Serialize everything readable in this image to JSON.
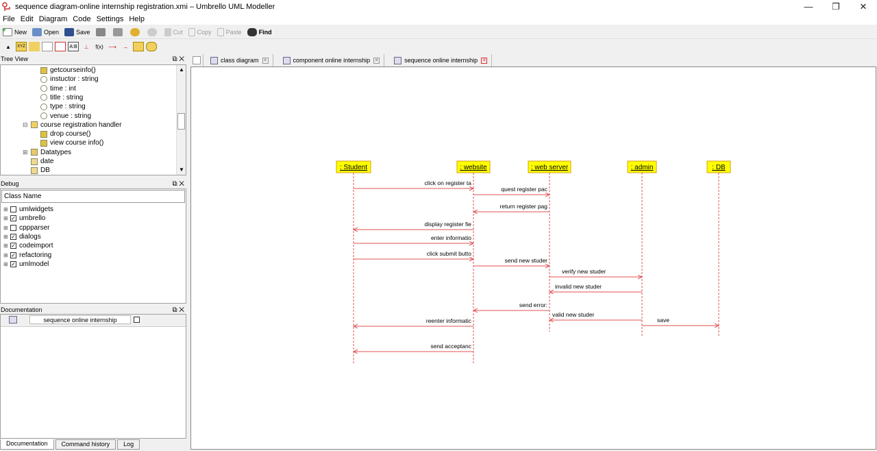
{
  "window": {
    "title": "sequence diagram-online internship registration.xmi – Umbrello UML Modeller",
    "controls": [
      "—",
      "❐",
      "✕"
    ]
  },
  "menu": [
    "File",
    "Edit",
    "Diagram",
    "Code",
    "Settings",
    "Help"
  ],
  "toolbar": {
    "new": "New",
    "open": "Open",
    "save": "Save",
    "cut": "Cut",
    "copy": "Copy",
    "paste": "Paste",
    "find": "Find"
  },
  "tree_view": {
    "title": "Tree View",
    "items": [
      {
        "label": "getcourseinfo()",
        "indent": 58,
        "icon": "operation"
      },
      {
        "label": "instuctor : string",
        "indent": 58,
        "icon": "attribute"
      },
      {
        "label": "time : int",
        "indent": 58,
        "icon": "attribute"
      },
      {
        "label": "title : string",
        "indent": 58,
        "icon": "attribute"
      },
      {
        "label": "type : string",
        "indent": 58,
        "icon": "attribute"
      },
      {
        "label": "venue : string",
        "indent": 58,
        "icon": "attribute"
      },
      {
        "label": "course registration handler",
        "indent": 44,
        "icon": "class",
        "expander": "⊟"
      },
      {
        "label": "drop course()",
        "indent": 58,
        "icon": "operation"
      },
      {
        "label": "view course info()",
        "indent": 58,
        "icon": "operation"
      },
      {
        "label": "Datatypes",
        "indent": 44,
        "icon": "folder",
        "expander": "⊞"
      },
      {
        "label": "date",
        "indent": 44,
        "icon": "datatype"
      },
      {
        "label": "DB",
        "indent": 44,
        "icon": "datatype"
      }
    ]
  },
  "debug": {
    "title": "Debug",
    "column": "Class Name",
    "items": [
      {
        "label": "umlwidgets",
        "checked": false
      },
      {
        "label": "umbrello",
        "checked": true
      },
      {
        "label": "cppparser",
        "checked": false
      },
      {
        "label": "dialogs",
        "checked": true
      },
      {
        "label": "codeimport",
        "checked": true
      },
      {
        "label": "refactoring",
        "checked": true
      },
      {
        "label": "umlmodel",
        "checked": true
      }
    ]
  },
  "documentation": {
    "title": "Documentation",
    "field": "sequence online internship",
    "tabs": [
      "Documentation",
      "Command history",
      "Log"
    ]
  },
  "tabs": [
    {
      "label": "class diagram",
      "active": false
    },
    {
      "label": "component online internship",
      "active": false
    },
    {
      "label": "sequence online internship",
      "active": true
    }
  ],
  "diagram": {
    "objects": [
      {
        "label": ": Student"
      },
      {
        "label": ": website"
      },
      {
        "label": ": web server"
      },
      {
        "label": ": admin"
      },
      {
        "label": ": DB"
      }
    ],
    "messages": [
      {
        "label": "click on register ta",
        "from": 0,
        "to": 1
      },
      {
        "label": "quest register pac",
        "from": 1,
        "to": 2
      },
      {
        "label": "return register pag",
        "from": 2,
        "to": 1
      },
      {
        "label": "display register fie",
        "from": 1,
        "to": 0
      },
      {
        "label": "enter informatio",
        "from": 0,
        "to": 1
      },
      {
        "label": "click submit butto",
        "from": 0,
        "to": 1
      },
      {
        "label": "send new studer",
        "from": 1,
        "to": 2
      },
      {
        "label": "verify new studer",
        "from": 2,
        "to": 3
      },
      {
        "label": "invalid new studer",
        "from": 3,
        "to": 2
      },
      {
        "label": "send error:",
        "from": 2,
        "to": 1
      },
      {
        "label": "valid new studer",
        "from": 3,
        "to": 2
      },
      {
        "label": "save",
        "from": 3,
        "to": 4
      },
      {
        "label": "reenter informatic",
        "from": 1,
        "to": 0
      },
      {
        "label": "send acceptanc",
        "from": 1,
        "to": 0
      }
    ],
    "colors": {
      "object_fill": "#ffff00",
      "object_border": "#d4a017",
      "message": "#e05050",
      "lifeline": "#e05050"
    }
  }
}
